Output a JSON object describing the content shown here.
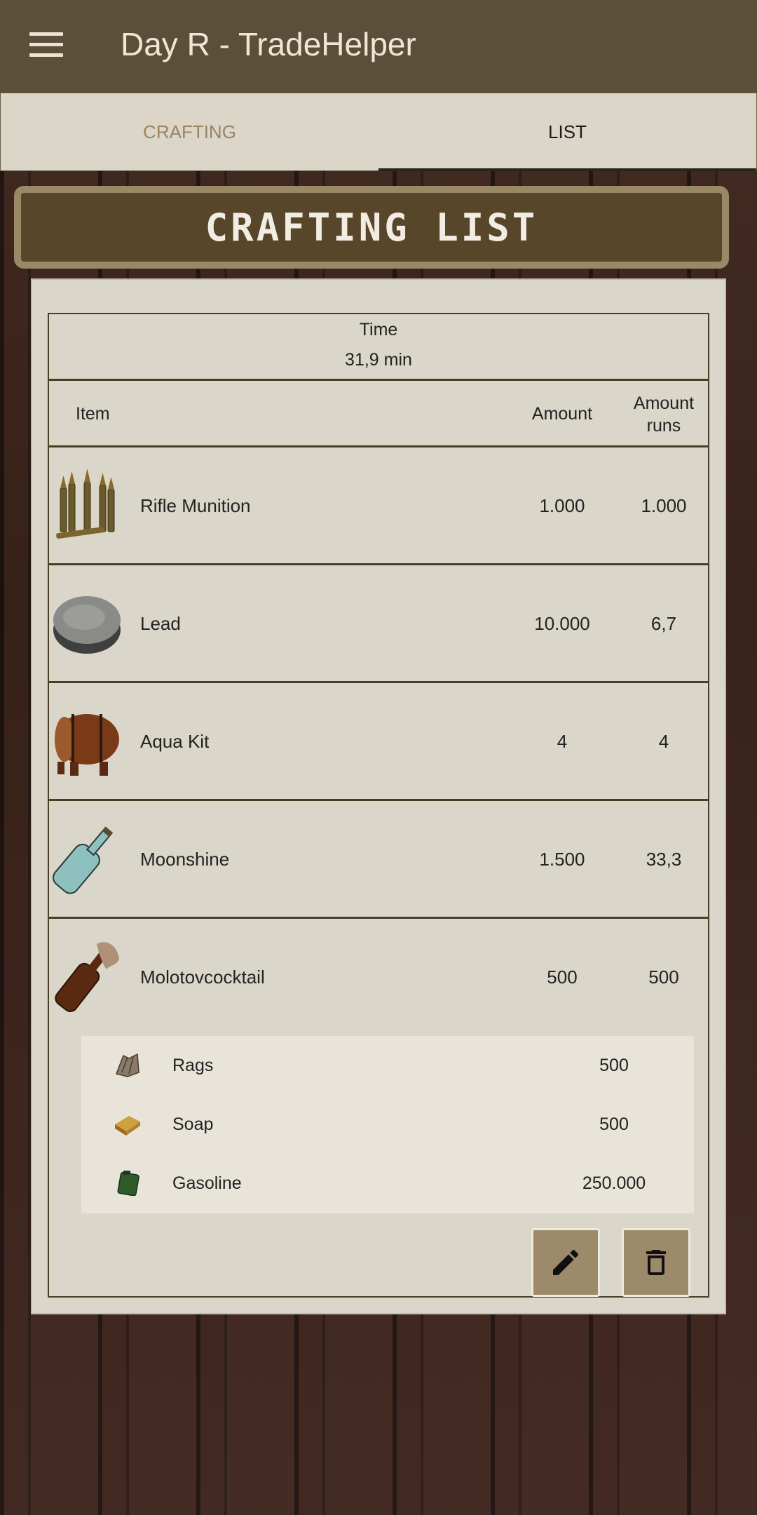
{
  "app": {
    "title": "Day R - TradeHelper"
  },
  "tabs": [
    {
      "label": "CRAFTING"
    },
    {
      "label": "LIST"
    }
  ],
  "banner": {
    "title": "CRAFTING LIST"
  },
  "summary": {
    "time_label": "Time",
    "time_value": "31,9 min"
  },
  "table": {
    "headers": {
      "item": "Item",
      "amount": "Amount",
      "runs": "Amount runs"
    },
    "rows": [
      {
        "name": "Rifle Munition",
        "amount": "1.000",
        "runs": "1.000",
        "icon": "bullets-icon"
      },
      {
        "name": "Lead",
        "amount": "10.000",
        "runs": "6,7",
        "icon": "lead-icon"
      },
      {
        "name": "Aqua Kit",
        "amount": "4",
        "runs": "4",
        "icon": "barrel-icon"
      },
      {
        "name": "Moonshine",
        "amount": "1.500",
        "runs": "33,3",
        "icon": "bottle-icon"
      },
      {
        "name": "Molotovcocktail",
        "amount": "500",
        "runs": "500",
        "icon": "molotov-icon"
      }
    ]
  },
  "ingredients": [
    {
      "name": "Rags",
      "amount": "500",
      "icon": "rags-icon"
    },
    {
      "name": "Soap",
      "amount": "500",
      "icon": "soap-icon"
    },
    {
      "name": "Gasoline",
      "amount": "250.000",
      "icon": "gas-can-icon"
    }
  ],
  "colors": {
    "appbar": "#5c4f3a",
    "banner": "#574629",
    "button": "#9c8a6a",
    "card": "#dad6c9"
  }
}
